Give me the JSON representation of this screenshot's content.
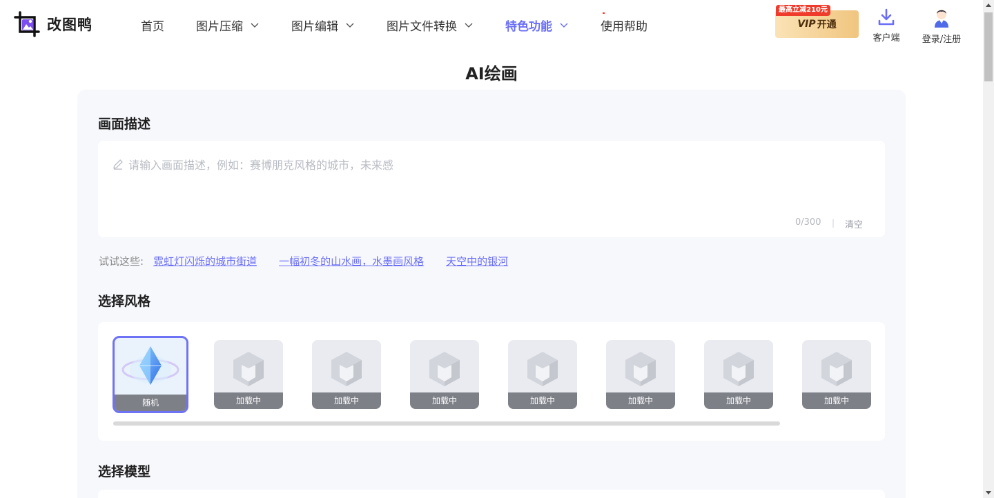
{
  "header": {
    "logo_text": "改图鸭",
    "nav": [
      {
        "label": "首页",
        "has_dropdown": false,
        "active": false
      },
      {
        "label": "图片压缩",
        "has_dropdown": true,
        "active": false
      },
      {
        "label": "图片编辑",
        "has_dropdown": true,
        "active": false
      },
      {
        "label": "图片文件转换",
        "has_dropdown": true,
        "active": false
      },
      {
        "label": "特色功能",
        "has_dropdown": true,
        "active": true
      },
      {
        "label": "使用帮助",
        "has_dropdown": false,
        "active": false
      }
    ],
    "vip_badge": "最高立减210元",
    "vip_label_italic": "VIP",
    "vip_label": "开通",
    "client_label": "客户端",
    "login_label": "登录/注册"
  },
  "page_title": "AI绘画",
  "description": {
    "title": "画面描述",
    "placeholder": "请输入画面描述，例如：赛博朋克风格的城市，未来感",
    "value": "",
    "counter": "0/300",
    "separator": "|",
    "clear_label": "清空"
  },
  "suggestions": {
    "label": "试试这些:",
    "items": [
      "霓虹灯闪烁的城市街道",
      "一幅初冬的山水画，水墨画风格",
      "天空中的银河"
    ]
  },
  "style": {
    "title": "选择风格",
    "cards": [
      "随机",
      "加载中",
      "加载中",
      "加载中",
      "加载中",
      "加载中",
      "加载中",
      "加载中"
    ],
    "selected_index": 0
  },
  "model": {
    "title": "选择模型"
  },
  "colors": {
    "accent": "#6a6ef7",
    "vip_gradient_start": "#fbe3b6",
    "vip_gradient_end": "#f0c57f",
    "badge_red": "#ee3b2b",
    "panel_bg": "#f7f8fc"
  },
  "icons": {
    "logo": "duck-image-logo-icon",
    "dropdown": "chevron-down-icon",
    "client": "download-icon",
    "login": "user-avatar-icon",
    "pencil": "pencil-icon",
    "loading_placeholder": "cube-placeholder-icon",
    "random_style": "crystal-gem-icon"
  }
}
